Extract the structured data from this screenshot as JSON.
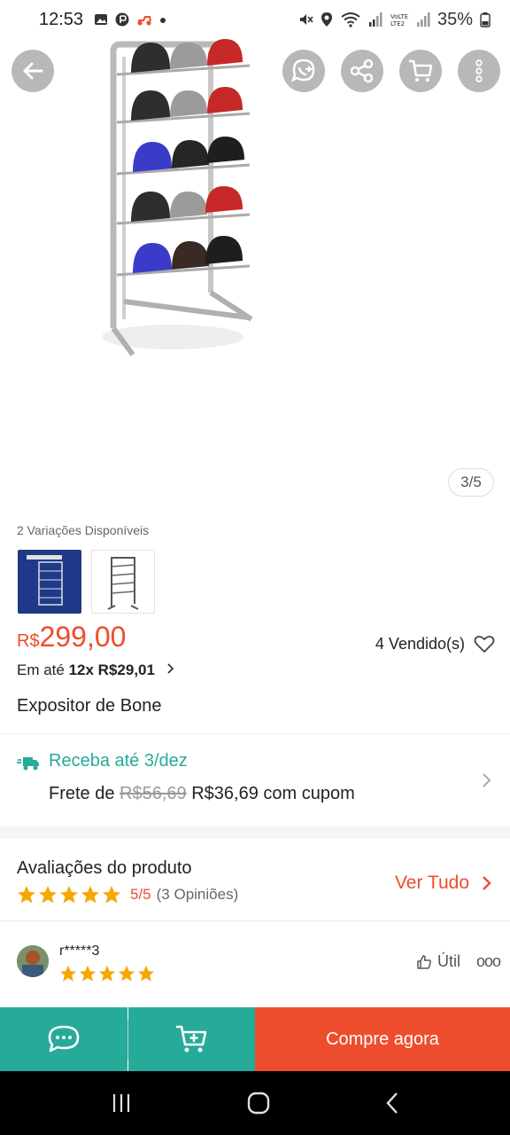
{
  "status_bar": {
    "time": "12:53",
    "battery": "35%"
  },
  "gallery": {
    "counter": "3/5",
    "top_buttons": [
      "back-arrow-icon",
      "whatsapp-share-icon",
      "share-icon",
      "shopping-cart-icon",
      "more-vertical-icon"
    ]
  },
  "variations": {
    "label": "2 Variações Disponíveis",
    "count": 2
  },
  "product": {
    "currency": "R$",
    "price": "299,00",
    "sold": "4 Vendido(s)",
    "installments_prefix": "Em até",
    "installments_value": "12x R$29,01",
    "title": "Expositor de Bone"
  },
  "shipping": {
    "date": "Receba até 3/dez",
    "fee_prefix": "Frete de",
    "old_fee": "R$56,69",
    "new_fee": "R$36,69 com cupom"
  },
  "reviews": {
    "title": "Avaliações do produto",
    "rating": "5/5",
    "count": "(3 Opiniões)",
    "stars": 5,
    "see_all": "Ver Tudo",
    "first_review": {
      "user": "r*****3",
      "stars": 5,
      "helpful_label": "Útil",
      "more_label": "ooo"
    }
  },
  "actions": {
    "buy_now": "Compre agora"
  },
  "colors": {
    "accent_orange": "#ee4d2d",
    "teal": "#26aa99",
    "star": "#f6a700"
  }
}
